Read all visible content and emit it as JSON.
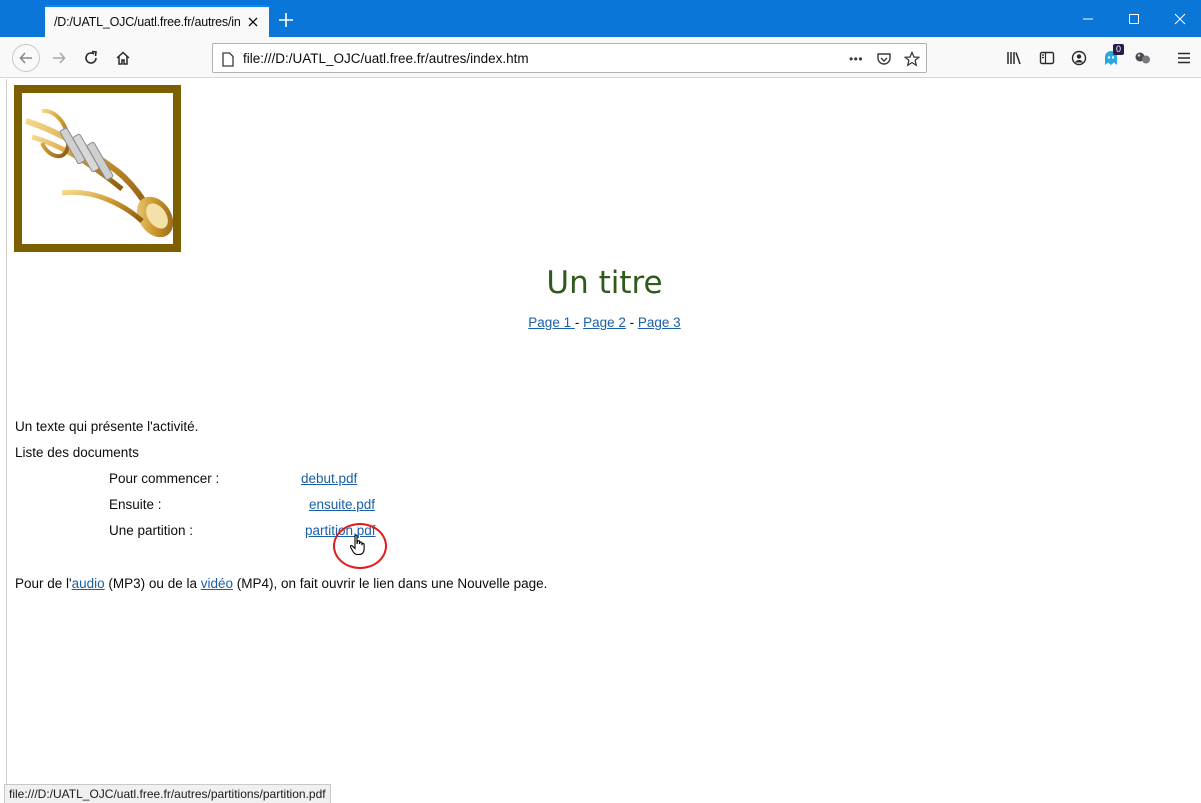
{
  "tab": {
    "title": "/D:/UATL_OJC/uatl.free.fr/autres/index.htm"
  },
  "url": "file:///D:/UATL_OJC/uatl.free.fr/autres/index.htm",
  "overflow_label": "•••",
  "notification_badge": "0",
  "page": {
    "title": "Un titre",
    "nav_links": [
      "Page 1 ",
      "Page 2",
      "Page 3"
    ],
    "nav_separator": " - ",
    "intro": "Un texte qui présente l'activité.",
    "list_heading": "Liste des documents",
    "documents": [
      {
        "label": "Pour commencer :",
        "file": "debut.pdf"
      },
      {
        "label": "Ensuite :",
        "file": "ensuite.pdf"
      },
      {
        "label": "Une partition :",
        "file": "partition.pdf"
      }
    ],
    "media_sentence": {
      "prefix": "Pour de l'",
      "audio_link": "audio",
      "audio_suffix": " (MP3) ou de la ",
      "video_link": "vidéo",
      "video_suffix": " (MP4), on fait ouvrir le lien dans une Nouvelle page."
    }
  },
  "status_bar": "file:///D:/UATL_OJC/uatl.free.fr/autres/partitions/partition.pdf",
  "colors": {
    "titlebar": "#0a76d8",
    "page_title": "#2f5a1c",
    "link": "#1a5fa8",
    "frame": "#7b5f00",
    "cursor_ring": "#e21a1a"
  },
  "icons": {
    "back": "arrow-left-icon",
    "forward": "arrow-right-icon",
    "reload": "reload-icon",
    "home": "home-icon",
    "page": "page-icon",
    "pocket": "pocket-icon",
    "bookmark": "star-icon",
    "library": "library-icon",
    "sidebar": "sidebar-icon",
    "account": "account-icon",
    "menu": "hamburger-menu-icon"
  }
}
